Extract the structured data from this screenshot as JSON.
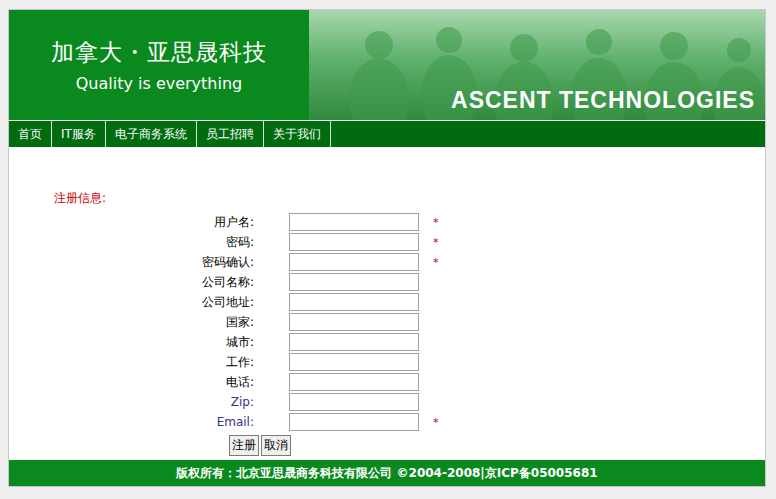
{
  "header": {
    "brand_cn": "加拿大・亚思晟科技",
    "tagline": "Quality is everything",
    "brand_en": "ASCENT TECHNOLOGIES"
  },
  "nav": [
    {
      "label": "首页"
    },
    {
      "label": "IT服务"
    },
    {
      "label": "电子商务系统"
    },
    {
      "label": "员工招聘"
    },
    {
      "label": "关于我们"
    }
  ],
  "form": {
    "title": "注册信息:",
    "required_mark": "*",
    "fields": [
      {
        "label": "用户名:",
        "required": true,
        "color": "#000000"
      },
      {
        "label": "密码:",
        "required": true,
        "color": "#000000"
      },
      {
        "label": "密码确认:",
        "required": true,
        "color": "#000000"
      },
      {
        "label": "公司名称:",
        "required": false,
        "color": "#000000"
      },
      {
        "label": "公司地址:",
        "required": false,
        "color": "#000000"
      },
      {
        "label": "国家:",
        "required": false,
        "color": "#000000"
      },
      {
        "label": "城市:",
        "required": false,
        "color": "#000000"
      },
      {
        "label": "工作:",
        "required": false,
        "color": "#000000"
      },
      {
        "label": "电话:",
        "required": false,
        "color": "#000000"
      },
      {
        "label": "Zip:",
        "required": false,
        "color": "#333388"
      },
      {
        "label": "Email:",
        "required": true,
        "color": "#333388"
      }
    ],
    "buttons": [
      "注册",
      "取消"
    ]
  },
  "footer": "版权所有：北京亚思晟商务科技有限公司 ©2004-2008|京ICP备05005681"
}
